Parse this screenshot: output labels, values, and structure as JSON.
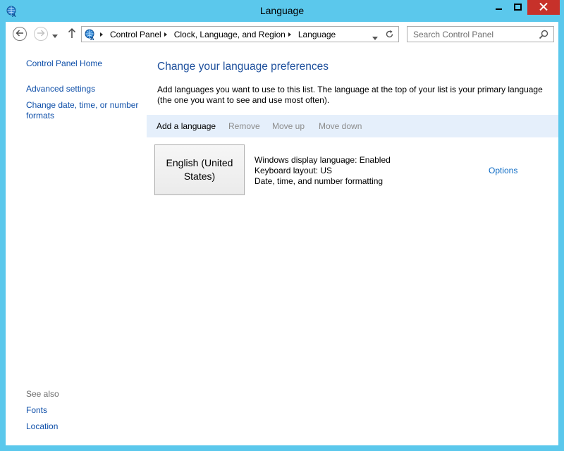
{
  "window": {
    "title": "Language"
  },
  "nav": {
    "breadcrumbs": [
      "Control Panel",
      "Clock, Language, and Region",
      "Language"
    ],
    "search_placeholder": "Search Control Panel"
  },
  "sidebar": {
    "home": "Control Panel Home",
    "advanced": "Advanced settings",
    "change_formats": "Change date, time, or number formats",
    "see_also": "See also",
    "fonts": "Fonts",
    "location": "Location"
  },
  "main": {
    "heading": "Change your language preferences",
    "description": "Add languages you want to use to this list. The language at the top of your list is your primary language (the one you want to see and use most often).",
    "toolbar": {
      "add": "Add a language",
      "remove": "Remove",
      "move_up": "Move up",
      "move_down": "Move down"
    },
    "languages": [
      {
        "name": "English (United States)",
        "display": "Windows display language: Enabled",
        "keyboard": "Keyboard layout: US",
        "formatting": "Date, time, and number formatting",
        "options": "Options"
      }
    ]
  },
  "colors": {
    "frame": "#5bc8ec",
    "close_button": "#c7312a",
    "link": "#0d4ea8",
    "heading": "#1d4f9c",
    "toolbar_bg": "#e5effb"
  },
  "icons": [
    "globe-icon",
    "back-arrow-icon",
    "forward-arrow-icon",
    "chevron-down-icon",
    "up-arrow-icon",
    "refresh-icon",
    "search-icon",
    "minimize-icon",
    "maximize-icon",
    "close-icon"
  ]
}
